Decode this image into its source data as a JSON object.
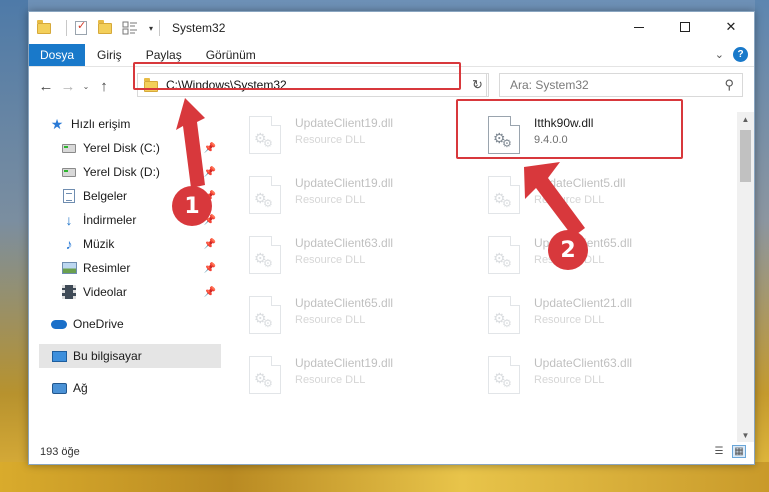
{
  "window": {
    "title": "System32",
    "controls": {
      "minimize": "",
      "maximize": "",
      "close": "✕"
    }
  },
  "quick_access_toolbar": {
    "dropdown": "▾"
  },
  "ribbon": {
    "tabs": [
      {
        "label": "Dosya",
        "active": true
      },
      {
        "label": "Giriş"
      },
      {
        "label": "Paylaş"
      },
      {
        "label": "Görünüm"
      }
    ],
    "expand_icon": "⌄",
    "help_label": "?"
  },
  "nav": {
    "back": "←",
    "forward": "→",
    "recent": "⌄",
    "up": "↑"
  },
  "address": {
    "path": "C:\\Windows\\System32",
    "dropdown": "⌄",
    "refresh": "↻"
  },
  "search": {
    "placeholder": "Ara: System32",
    "icon": "⚲"
  },
  "sidebar": {
    "items": [
      {
        "label": "Hızlı erişim",
        "icon": "star-icon"
      },
      {
        "label": "Yerel Disk (C:)",
        "icon": "drive-icon",
        "pinned": true
      },
      {
        "label": "Yerel Disk (D:)",
        "icon": "drive-icon",
        "pinned": true
      },
      {
        "label": "Belgeler",
        "icon": "document-icon",
        "pinned": true
      },
      {
        "label": "İndirmeler",
        "icon": "download-icon",
        "pinned": true
      },
      {
        "label": "Müzik",
        "icon": "music-icon",
        "pinned": true
      },
      {
        "label": "Resimler",
        "icon": "pictures-icon",
        "pinned": true
      },
      {
        "label": "Videolar",
        "icon": "videos-icon",
        "pinned": true
      },
      {
        "label": "OneDrive",
        "icon": "onedrive-icon"
      },
      {
        "label": "Bu bilgisayar",
        "icon": "this-pc-icon",
        "selected": true
      },
      {
        "label": "Ağ",
        "icon": "network-icon"
      }
    ],
    "pin_glyph": "📌"
  },
  "files": [
    {
      "name": "UpdateClient19.dll",
      "type": "Resource DLL"
    },
    {
      "name": "Itthk90w.dll",
      "type": "9.4.0.0",
      "highlighted": true
    },
    {
      "name": "UpdateClient19.dll",
      "type": "Resource DLL"
    },
    {
      "name": "UpdateClient5.dll",
      "type": "Resource DLL"
    },
    {
      "name": "UpdateClient63.dll",
      "type": "Resource DLL"
    },
    {
      "name": "UpdateClient65.dll",
      "type": "Resource DLL"
    },
    {
      "name": "UpdateClient65.dll",
      "type": "Resource DLL"
    },
    {
      "name": "UpdateClient21.dll",
      "type": "Resource DLL"
    },
    {
      "name": "UpdateClient19.dll",
      "type": "Resource DLL"
    },
    {
      "name": "UpdateClient63.dll",
      "type": "Resource DLL"
    }
  ],
  "scrollbar": {
    "up": "▲",
    "down": "▼"
  },
  "status": {
    "item_count": "193 öğe",
    "view_details": "☰",
    "view_tiles": "▦"
  },
  "annotations": {
    "callout_1": "1",
    "callout_2": "2",
    "color": "#d8383c"
  }
}
